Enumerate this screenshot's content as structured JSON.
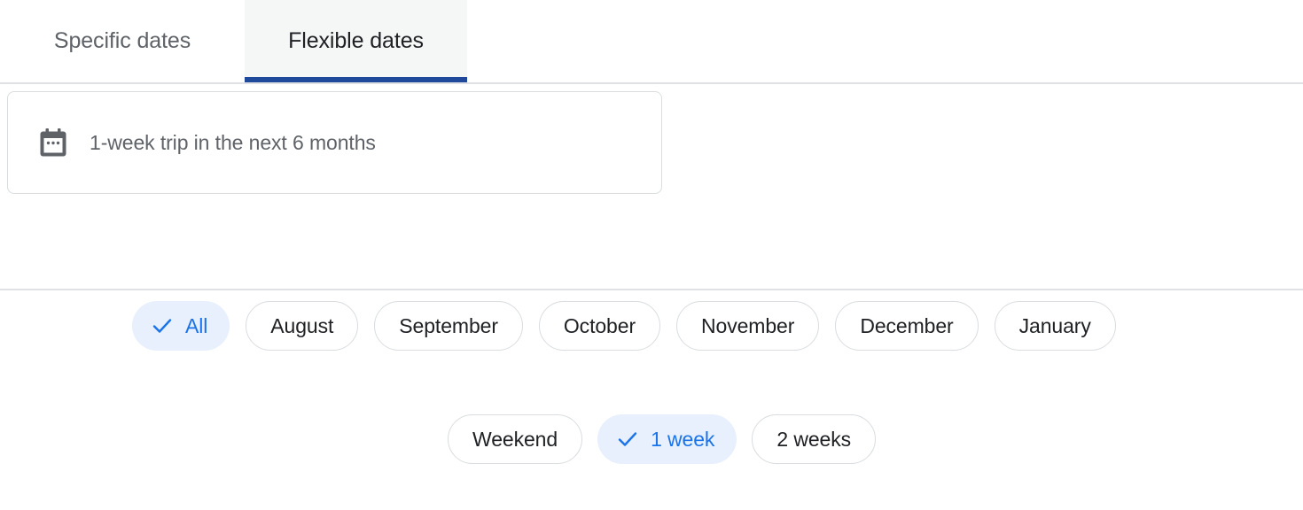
{
  "tabs": [
    {
      "id": "specific-dates",
      "label": "Specific dates",
      "active": false
    },
    {
      "id": "flexible-dates",
      "label": "Flexible dates",
      "active": true
    }
  ],
  "date_field": {
    "icon": "calendar-icon",
    "value": "1-week trip in the next 6 months"
  },
  "month_chips": [
    {
      "id": "all",
      "label": "All",
      "selected": true
    },
    {
      "id": "august",
      "label": "August",
      "selected": false
    },
    {
      "id": "september",
      "label": "September",
      "selected": false
    },
    {
      "id": "october",
      "label": "October",
      "selected": false
    },
    {
      "id": "november",
      "label": "November",
      "selected": false
    },
    {
      "id": "december",
      "label": "December",
      "selected": false
    },
    {
      "id": "january",
      "label": "January",
      "selected": false
    }
  ],
  "duration_chips": [
    {
      "id": "weekend",
      "label": "Weekend",
      "selected": false
    },
    {
      "id": "1-week",
      "label": "1 week",
      "selected": true
    },
    {
      "id": "2-weeks",
      "label": "2 weeks",
      "selected": false
    }
  ],
  "colors": {
    "accent_blue": "#1a73e8",
    "selected_chip_bg": "#e8f0fe",
    "active_tab_underline": "#1f4a9c",
    "active_tab_bg": "#f5f6f6",
    "divider": "#dfe1e5",
    "chip_border": "#dadce0",
    "text_primary": "#202124",
    "text_secondary": "#5f6368"
  }
}
